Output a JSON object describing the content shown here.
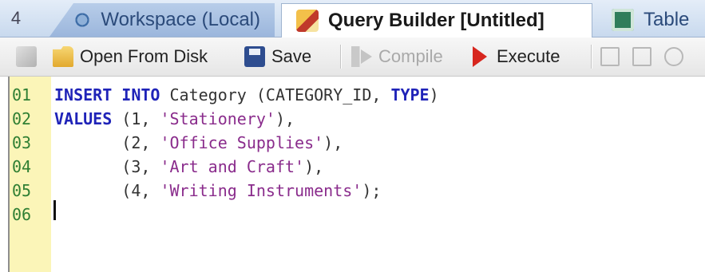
{
  "tabs": {
    "scroll_glyph": "4",
    "items": [
      {
        "label": "Workspace (Local)",
        "icon": "workspace-icon"
      },
      {
        "label": "Query Builder [Untitled]",
        "icon": "query-builder-icon",
        "active": true
      },
      {
        "label": "Table",
        "icon": "table-icon"
      }
    ]
  },
  "toolbar": {
    "open_label": "Open From Disk",
    "save_label": "Save",
    "compile_label": "Compile",
    "execute_label": "Execute"
  },
  "editor": {
    "line_numbers": [
      "01",
      "02",
      "03",
      "04",
      "05",
      "06"
    ],
    "lines": [
      [
        {
          "t": "INSERT INTO",
          "k": "kw"
        },
        {
          "t": " Category (CATEGORY_ID, ",
          "k": "plain"
        },
        {
          "t": "TYPE",
          "k": "kw"
        },
        {
          "t": ")",
          "k": "plain"
        }
      ],
      [
        {
          "t": "VALUES",
          "k": "kw"
        },
        {
          "t": " (1, ",
          "k": "plain"
        },
        {
          "t": "'Stationery'",
          "k": "str"
        },
        {
          "t": "),",
          "k": "plain"
        }
      ],
      [
        {
          "t": "       (2, ",
          "k": "plain"
        },
        {
          "t": "'Office Supplies'",
          "k": "str"
        },
        {
          "t": "),",
          "k": "plain"
        }
      ],
      [
        {
          "t": "       (3, ",
          "k": "plain"
        },
        {
          "t": "'Art and Craft'",
          "k": "str"
        },
        {
          "t": "),",
          "k": "plain"
        }
      ],
      [
        {
          "t": "       (4, ",
          "k": "plain"
        },
        {
          "t": "'Writing Instruments'",
          "k": "str"
        },
        {
          "t": ");",
          "k": "plain"
        }
      ],
      []
    ],
    "colors": {
      "gutter": "#fbf5b8",
      "line_number": "#2f7f33",
      "keyword": "#1f23b8",
      "string": "#8a2c8c"
    }
  }
}
